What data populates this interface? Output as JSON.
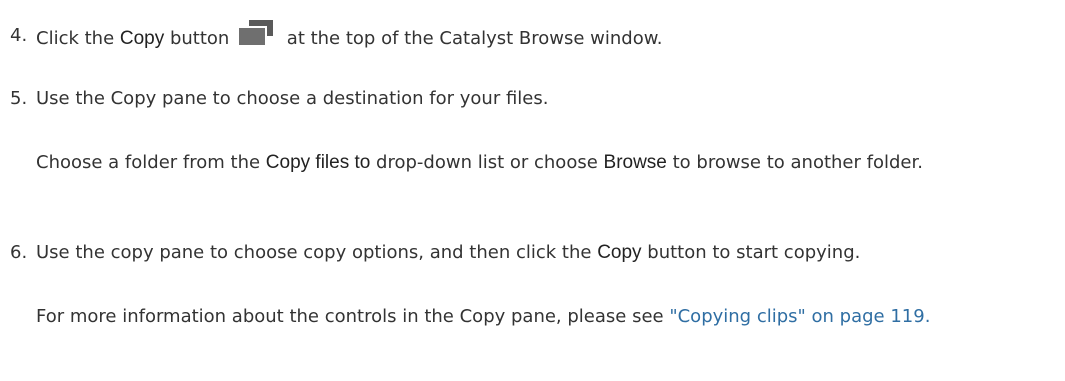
{
  "steps": [
    {
      "number": "4.",
      "before": "Click the ",
      "bold": "Copy",
      "middle": " button ",
      "icon": "copy-icon",
      "after": " at the top of the Catalyst Browse window."
    },
    {
      "number": "5.",
      "text": "Use the Copy pane to choose a destination for your files.",
      "note_part1": "Choose a folder from the ",
      "note_bold1": "Copy files to",
      "note_part2": " drop-down list or choose ",
      "note_bold2": "Browse",
      "note_part3": " to browse to another folder."
    },
    {
      "number": "6.",
      "before": "Use the copy pane to choose copy options, and then click the ",
      "bold": "Copy",
      "after": " button to start copying.",
      "note_text": "For more information about the controls in the Copy pane, please see ",
      "note_link": "\"Copying clips\" on page 119."
    }
  ]
}
